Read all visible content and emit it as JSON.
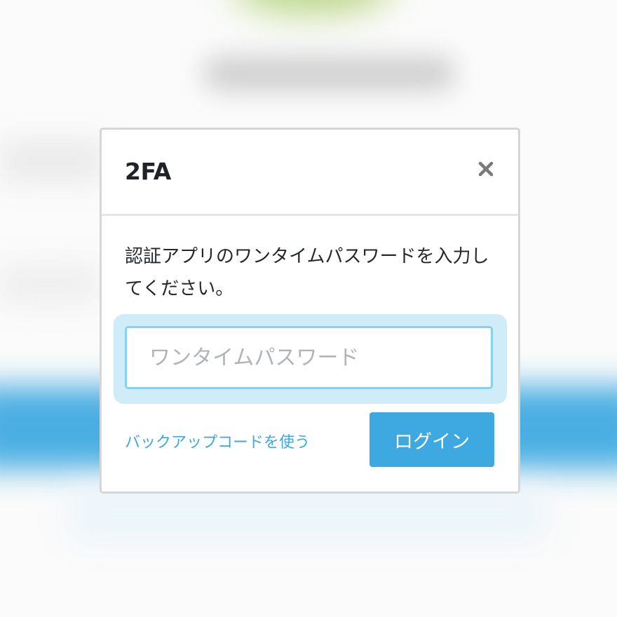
{
  "dialog": {
    "title": "2FA",
    "close_icon": "close-icon",
    "description": "認証アプリのワンタイムパスワードを入力してください。",
    "otp_input": {
      "value": "",
      "placeholder": "ワンタイムパスワード"
    },
    "backup_link_label": "バックアップコードを使う",
    "login_button_label": "ログイン"
  },
  "colors": {
    "accent": "#3ea8e0",
    "focus_ring": "#d1ecf9",
    "input_border": "#85d1f2",
    "title_text": "#1f2328"
  }
}
